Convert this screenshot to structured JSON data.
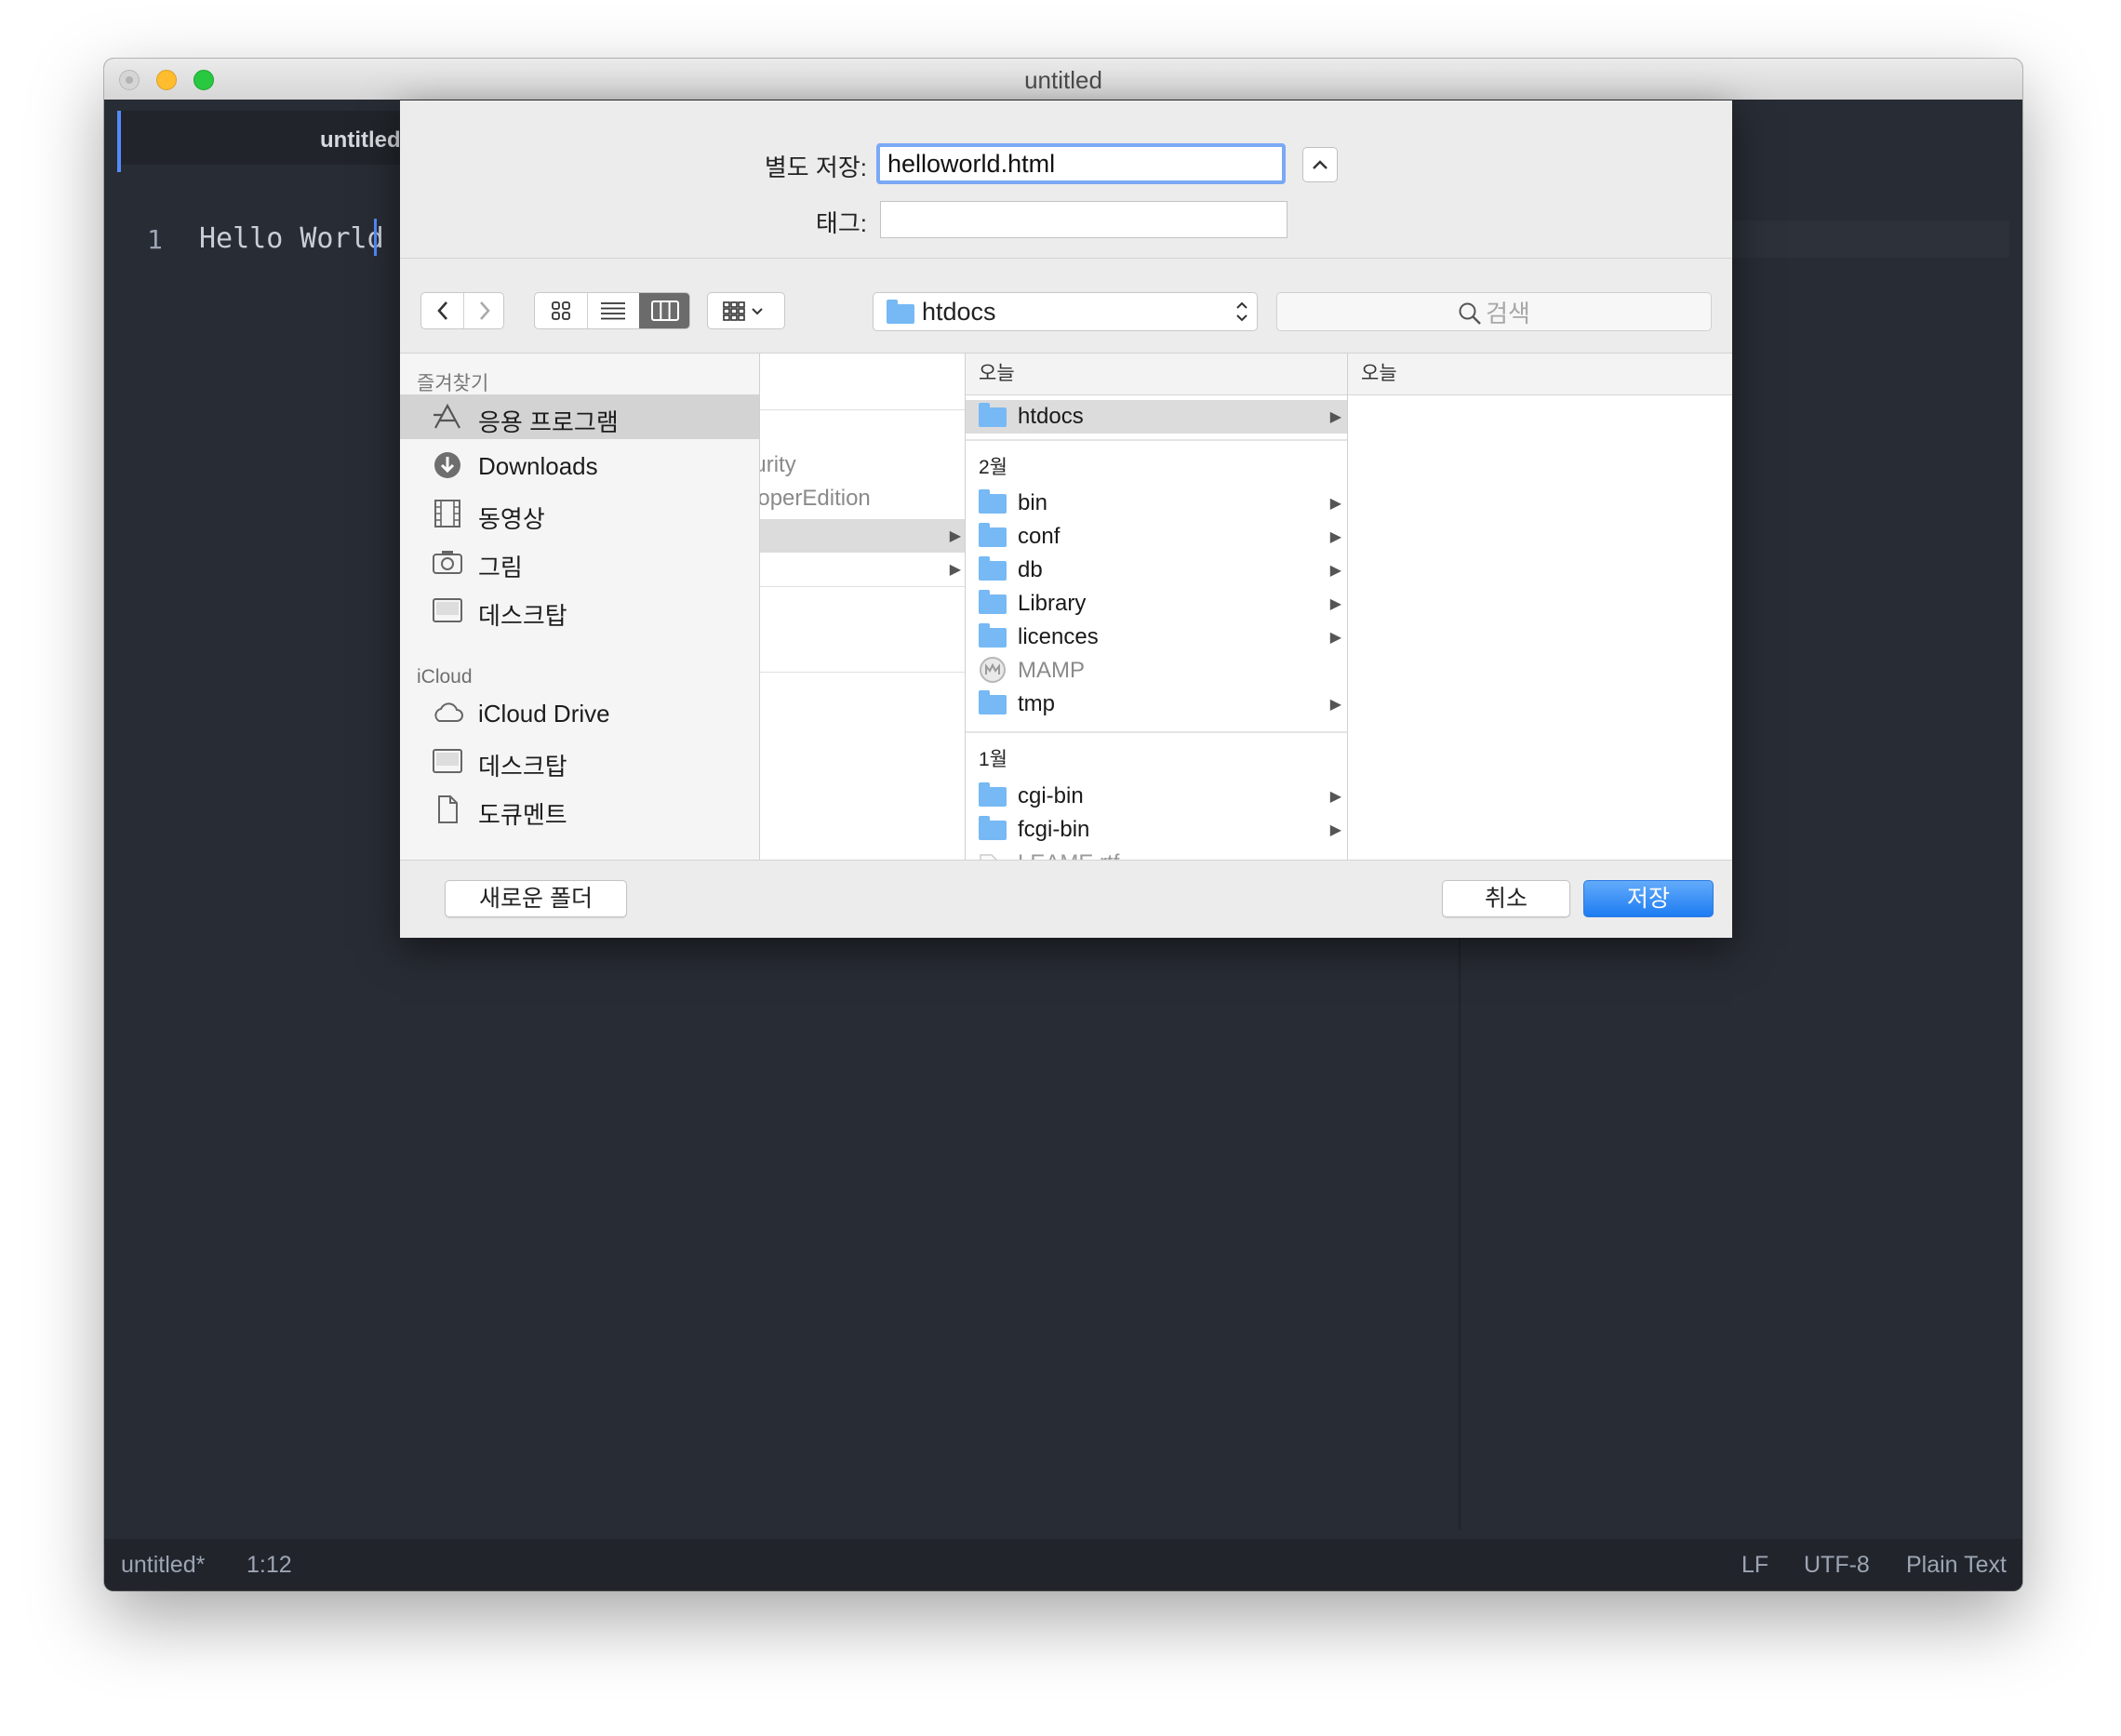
{
  "window": {
    "title": "untitled"
  },
  "editor": {
    "tab_label": "untitled",
    "line_number": "1",
    "line_text": "Hello World"
  },
  "statusbar": {
    "filename": "untitled*",
    "position": "1:12",
    "line_ending": "LF",
    "encoding": "UTF-8",
    "grammar": "Plain Text"
  },
  "dialog": {
    "save_as_label": "별도 저장:",
    "save_as_value": "helloworld.html",
    "tags_label": "태그:",
    "path_popup": "htdocs",
    "search_placeholder": "검색",
    "sidebar": {
      "favorites_title": "즐겨찾기",
      "favorites": [
        {
          "label": "응용 프로그램",
          "icon": "applications-icon"
        },
        {
          "label": "Downloads",
          "icon": "downloads-icon"
        },
        {
          "label": "동영상",
          "icon": "movies-icon"
        },
        {
          "label": "그림",
          "icon": "pictures-icon"
        },
        {
          "label": "데스크탑",
          "icon": "desktop-icon"
        }
      ],
      "icloud_title": "iCloud",
      "icloud": [
        {
          "label": "iCloud Drive",
          "icon": "icloud-drive-icon"
        },
        {
          "label": "데스크탑",
          "icon": "desktop-icon"
        },
        {
          "label": "도큐멘트",
          "icon": "documents-icon"
        }
      ]
    },
    "column1": {
      "items": [
        "Security",
        "DeveloperEdition"
      ]
    },
    "column2": {
      "header": "오늘",
      "group_today_item": "htdocs",
      "group_feb_title": "2월",
      "group_feb": [
        "bin",
        "conf",
        "db",
        "Library",
        "licences",
        "MAMP",
        "tmp"
      ],
      "group_jan_title": "1월",
      "group_jan": [
        "cgi-bin",
        "fcgi-bin",
        "LEAME.rtf"
      ]
    },
    "column3": {
      "header": "오늘"
    },
    "new_folder_button": "새로운 폴더",
    "cancel_button": "취소",
    "save_button": "저장"
  }
}
